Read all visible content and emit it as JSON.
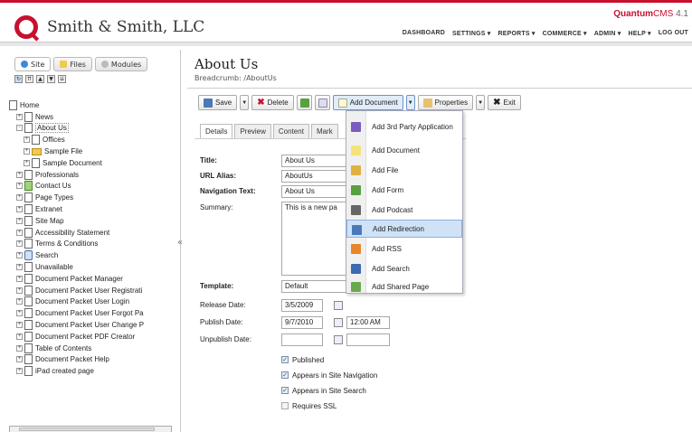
{
  "header": {
    "company": "Smith & Smith, LLC",
    "brand_main": "Quantum",
    "brand_cms": "CMS",
    "brand_version": "4.1",
    "nav": [
      "DASHBOARD",
      "SETTINGS ▾",
      "REPORTS ▾",
      "COMMERCE ▾",
      "ADMIN ▾",
      "HELP ▾",
      "LOG OUT"
    ]
  },
  "sidebar": {
    "tabs": [
      {
        "label": "Site",
        "icon": "globe-icon"
      },
      {
        "label": "Files",
        "icon": "folder-icon"
      },
      {
        "label": "Modules",
        "icon": "module-icon"
      }
    ],
    "tools": [
      "▲",
      "▼",
      "▼"
    ],
    "tree": [
      {
        "label": "Home",
        "level": 0,
        "toggle": "",
        "icon": "page"
      },
      {
        "label": "News",
        "level": 1,
        "toggle": "+",
        "icon": "page"
      },
      {
        "label": "About Us",
        "level": 1,
        "toggle": "-",
        "icon": "page"
      },
      {
        "label": "Offices",
        "level": 2,
        "toggle": "+",
        "icon": "page"
      },
      {
        "label": "Sample File",
        "level": 2,
        "toggle": "+",
        "icon": "folder"
      },
      {
        "label": "Sample Document",
        "level": 2,
        "toggle": "+",
        "icon": "page"
      },
      {
        "label": "Professionals",
        "level": 1,
        "toggle": "+",
        "icon": "page"
      },
      {
        "label": "Contact Us",
        "level": 1,
        "toggle": "+",
        "icon": "green"
      },
      {
        "label": "Page Types",
        "level": 1,
        "toggle": "+",
        "icon": "page"
      },
      {
        "label": "Extranet",
        "level": 1,
        "toggle": "+",
        "icon": "page"
      },
      {
        "label": "Site Map",
        "level": 1,
        "toggle": "+",
        "icon": "page"
      },
      {
        "label": "Accessibility Statement",
        "level": 1,
        "toggle": "+",
        "icon": "page"
      },
      {
        "label": "Terms & Conditions",
        "level": 1,
        "toggle": "+",
        "icon": "page"
      },
      {
        "label": "Search",
        "level": 1,
        "toggle": "+",
        "icon": "globe"
      },
      {
        "label": "Unavailable",
        "level": 1,
        "toggle": "+",
        "icon": "page"
      },
      {
        "label": "Document Packet Manager",
        "level": 1,
        "toggle": "+",
        "icon": "page"
      },
      {
        "label": "Document Packet User Registrati",
        "level": 1,
        "toggle": "+",
        "icon": "page"
      },
      {
        "label": "Document Packet User Login",
        "level": 1,
        "toggle": "+",
        "icon": "page"
      },
      {
        "label": "Document Packet User Forgot Pa",
        "level": 1,
        "toggle": "+",
        "icon": "page"
      },
      {
        "label": "Document Packet User Change P",
        "level": 1,
        "toggle": "+",
        "icon": "page"
      },
      {
        "label": "Document Packet PDF Creator",
        "level": 1,
        "toggle": "+",
        "icon": "page"
      },
      {
        "label": "Table of Contents",
        "level": 1,
        "toggle": "+",
        "icon": "page"
      },
      {
        "label": "Document Packet Help",
        "level": 1,
        "toggle": "+",
        "icon": "page"
      },
      {
        "label": "iPad created page",
        "level": 1,
        "toggle": "+",
        "icon": "page"
      }
    ],
    "collapse_glyph": "«"
  },
  "main": {
    "title": "About Us",
    "breadcrumb": "Breadcrumb: /AboutUs",
    "toolbar": {
      "save": "Save",
      "delete": "Delete",
      "add_document": "Add Document",
      "properties": "Properties",
      "exit": "Exit"
    },
    "tabs": [
      "Details",
      "Preview",
      "Content",
      "Mark"
    ],
    "form": {
      "title_label": "Title:",
      "title_value": "About Us",
      "alias_label": "URL Alias:",
      "alias_value": "AboutUs",
      "navtext_label": "Navigation Text:",
      "navtext_value": "About Us",
      "summary_label": "Summary:",
      "summary_value": "This is a new pa",
      "template_label": "Template:",
      "template_value": "Default",
      "release_label": "Release Date:",
      "release_value": "3/5/2009",
      "publish_label": "Publish Date:",
      "publish_value": "9/7/2010",
      "publish_time": "12:00 AM",
      "unpublish_label": "Unpublish Date:",
      "checkboxes": [
        {
          "label": "Published",
          "checked": true
        },
        {
          "label": "Appears in Site Navigation",
          "checked": true
        },
        {
          "label": "Appears in Site Search",
          "checked": true
        },
        {
          "label": "Requires SSL",
          "checked": false
        }
      ]
    },
    "add_menu": [
      {
        "label": "Add 3rd Party Application",
        "icon": "app-icon",
        "color": "#7a5cc0"
      },
      {
        "label": "Add Document",
        "icon": "document-icon",
        "color": "#f6e27a"
      },
      {
        "label": "Add File",
        "icon": "file-icon",
        "color": "#e0b040"
      },
      {
        "label": "Add Form",
        "icon": "form-icon",
        "color": "#5aa040"
      },
      {
        "label": "Add Podcast",
        "icon": "podcast-icon",
        "color": "#666666"
      },
      {
        "label": "Add Redirection",
        "icon": "redirect-icon",
        "color": "#4a78b8"
      },
      {
        "label": "Add RSS",
        "icon": "rss-icon",
        "color": "#e8862a"
      },
      {
        "label": "Add Search",
        "icon": "search-icon",
        "color": "#3a6ab0"
      },
      {
        "label": "Add Shared Page",
        "icon": "shared-page-icon",
        "color": "#6aa84f"
      }
    ],
    "highlighted_menu_item": "Add Redirection"
  },
  "colors": {
    "brand_red": "#c8102e",
    "highlight": "#cfe2f6"
  }
}
